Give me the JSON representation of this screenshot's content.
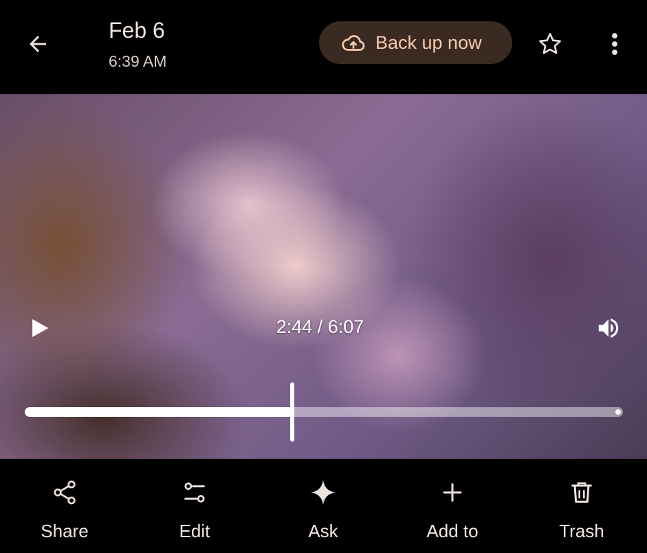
{
  "header": {
    "date": "Feb 6",
    "time": "6:39 AM",
    "backup_label": "Back up now",
    "icons": {
      "back": "arrow-back-icon",
      "backup": "cloud-upload-icon",
      "favorite": "star-outline-icon",
      "more": "more-vert-icon"
    }
  },
  "player": {
    "time_readout": "2:44 / 6:07",
    "progress_fraction": 0.447,
    "icons": {
      "play": "play-icon",
      "volume": "volume-icon"
    }
  },
  "actions": [
    {
      "label": "Share",
      "icon": "share-icon"
    },
    {
      "label": "Edit",
      "icon": "tune-icon"
    },
    {
      "label": "Ask",
      "icon": "sparkle-icon"
    },
    {
      "label": "Add to",
      "icon": "add-icon"
    },
    {
      "label": "Trash",
      "icon": "trash-icon"
    }
  ],
  "colors": {
    "background": "#000000",
    "backup_button_bg": "#3a2a22",
    "backup_accent": "#f6c9ae",
    "text_primary": "#f1e7e2"
  }
}
